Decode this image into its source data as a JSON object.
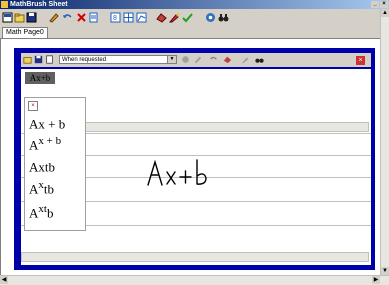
{
  "window": {
    "title": "MathBrush Sheet"
  },
  "tabs": [
    {
      "label": "Math Page0"
    }
  ],
  "panel": {
    "mode_selected": "When requested",
    "recognized": "Ax+b"
  },
  "candidates": [
    {
      "base": "Ax + b",
      "sup": "",
      "tail": ""
    },
    {
      "base": "A",
      "sup": "x + b",
      "tail": ""
    },
    {
      "base": "Axtb",
      "sup": "",
      "tail": ""
    },
    {
      "base": "A",
      "sup": "x",
      "tail": "tb"
    },
    {
      "base": "A",
      "sup": "xt",
      "tail": "b"
    }
  ],
  "ink": {
    "text": "Ax+b"
  }
}
